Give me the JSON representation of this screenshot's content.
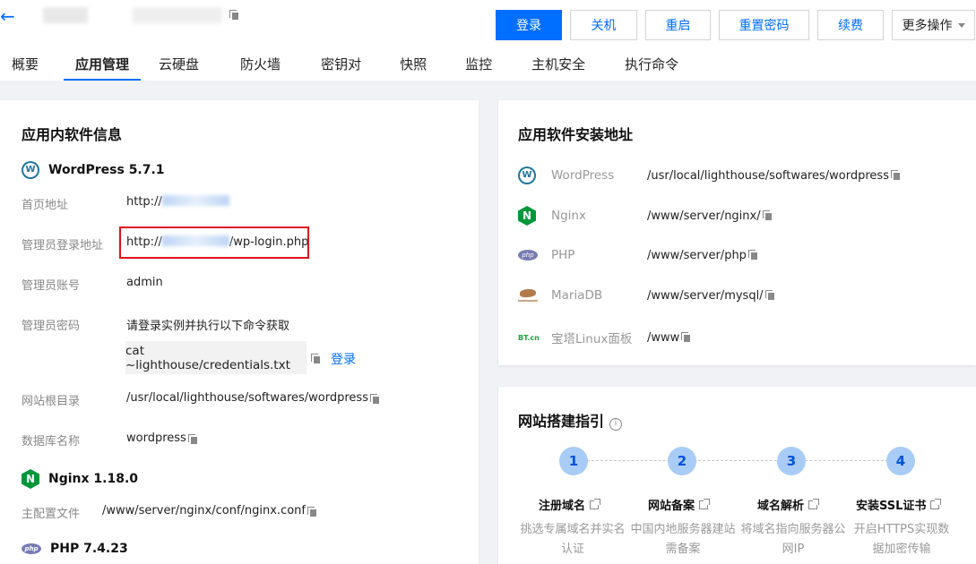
{
  "header": {
    "back_glyph": "←",
    "actions": [
      {
        "label": "登录",
        "primary": true
      },
      {
        "label": "关机"
      },
      {
        "label": "重启"
      },
      {
        "label": "重置密码"
      },
      {
        "label": "续费"
      },
      {
        "label": "更多操作"
      }
    ]
  },
  "tabs": [
    "概要",
    "应用管理",
    "云硬盘",
    "防火墙",
    "密钥对",
    "快照",
    "监控",
    "主机安全",
    "执行命令"
  ],
  "active_tab": "应用管理",
  "left": {
    "title": "应用内软件信息",
    "wordpress": {
      "name": "WordPress 5.7.1",
      "homepage_label": "首页地址",
      "homepage_prefix": "http://",
      "admin_url_label": "管理员登录地址",
      "admin_url_prefix": "http://",
      "admin_url_suffix": "/wp-login.php",
      "admin_user_label": "管理员账号",
      "admin_user": "admin",
      "admin_pass_label": "管理员密码",
      "admin_pass_hint": "请登录实例并执行以下命令获取",
      "command": "cat ~lighthouse/credentials.txt",
      "login_link": "登录",
      "root_label": "网站根目录",
      "root_path": "/usr/local/lighthouse/softwares/wordpress",
      "db_label": "数据库名称",
      "db_name": "wordpress"
    },
    "nginx": {
      "name": "Nginx 1.18.0",
      "conf_label": "主配置文件",
      "conf_path": "/www/server/nginx/conf/nginx.conf"
    },
    "php": {
      "name": "PHP 7.4.23"
    }
  },
  "right_top": {
    "title": "应用软件安装地址",
    "items": [
      {
        "icon": "wordpress-icon",
        "name": "WordPress",
        "path": "/usr/local/lighthouse/softwares/wordpress"
      },
      {
        "icon": "nginx-icon",
        "name": "Nginx",
        "path": "/www/server/nginx/"
      },
      {
        "icon": "php-icon",
        "name": "PHP",
        "path": "/www/server/php"
      },
      {
        "icon": "mariadb-icon",
        "name": "MariaDB",
        "path": "/www/server/mysql/"
      },
      {
        "icon": "bt-panel-icon",
        "name": "宝塔Linux面板",
        "path": "/www"
      }
    ],
    "bt_logo_text": "BT.cn"
  },
  "right_bottom": {
    "title": "网站搭建指引",
    "steps": [
      {
        "num": "1",
        "title": "注册域名",
        "desc_lines": [
          "挑选专属域名并实名",
          "认证"
        ]
      },
      {
        "num": "2",
        "title": "网站备案",
        "desc_lines": [
          "中国内地服务器建站",
          "需备案"
        ]
      },
      {
        "num": "3",
        "title": "域名解析",
        "desc_lines": [
          "将域名指向服务器公",
          "网IP"
        ]
      },
      {
        "num": "4",
        "title": "安装SSL证书",
        "desc_lines": [
          "开启HTTPS实现数",
          "据加密传输"
        ]
      }
    ]
  },
  "colors": {
    "accent": "#006eff",
    "highlight_border": "#e0111b",
    "step_circle": "#a9ccf6"
  }
}
